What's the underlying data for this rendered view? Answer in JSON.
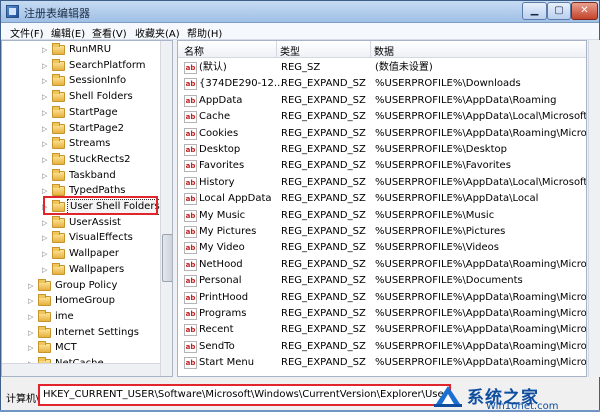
{
  "window": {
    "title": "注册表编辑器"
  },
  "menu": [
    "文件(F)",
    "编辑(E)",
    "查看(V)",
    "收藏夹(A)",
    "帮助(H)"
  ],
  "tree": {
    "items": [
      {
        "label": "RunMRU"
      },
      {
        "label": "SearchPlatform"
      },
      {
        "label": "SessionInfo"
      },
      {
        "label": "Shell Folders"
      },
      {
        "label": "StartPage"
      },
      {
        "label": "StartPage2"
      },
      {
        "label": "Streams"
      },
      {
        "label": "StuckRects2"
      },
      {
        "label": "Taskband"
      },
      {
        "label": "TypedPaths"
      },
      {
        "label": "User Shell Folders",
        "selected": true
      },
      {
        "label": "UserAssist"
      },
      {
        "label": "VisualEffects"
      },
      {
        "label": "Wallpaper"
      },
      {
        "label": "Wallpapers"
      },
      {
        "label": "Group Policy"
      },
      {
        "label": "HomeGroup"
      },
      {
        "label": "ime"
      },
      {
        "label": "Internet Settings"
      },
      {
        "label": "MCT"
      },
      {
        "label": "NetCache"
      }
    ]
  },
  "list": {
    "columns": [
      "名称",
      "类型",
      "数据"
    ],
    "rows": [
      {
        "name": "(默认)",
        "type": "REG_SZ",
        "data": "(数值未设置)"
      },
      {
        "name": "{374DE290-12...",
        "type": "REG_EXPAND_SZ",
        "data": "%USERPROFILE%\\Downloads"
      },
      {
        "name": "AppData",
        "type": "REG_EXPAND_SZ",
        "data": "%USERPROFILE%\\AppData\\Roaming"
      },
      {
        "name": "Cache",
        "type": "REG_EXPAND_SZ",
        "data": "%USERPROFILE%\\AppData\\Local\\Microsoft\\..."
      },
      {
        "name": "Cookies",
        "type": "REG_EXPAND_SZ",
        "data": "%USERPROFILE%\\AppData\\Roaming\\Microso"
      },
      {
        "name": "Desktop",
        "type": "REG_EXPAND_SZ",
        "data": "%USERPROFILE%\\Desktop"
      },
      {
        "name": "Favorites",
        "type": "REG_EXPAND_SZ",
        "data": "%USERPROFILE%\\Favorites"
      },
      {
        "name": "History",
        "type": "REG_EXPAND_SZ",
        "data": "%USERPROFILE%\\AppData\\Local\\Microsoft\\..."
      },
      {
        "name": "Local AppData",
        "type": "REG_EXPAND_SZ",
        "data": "%USERPROFILE%\\AppData\\Local"
      },
      {
        "name": "My Music",
        "type": "REG_EXPAND_SZ",
        "data": "%USERPROFILE%\\Music"
      },
      {
        "name": "My Pictures",
        "type": "REG_EXPAND_SZ",
        "data": "%USERPROFILE%\\Pictures"
      },
      {
        "name": "My Video",
        "type": "REG_EXPAND_SZ",
        "data": "%USERPROFILE%\\Videos"
      },
      {
        "name": "NetHood",
        "type": "REG_EXPAND_SZ",
        "data": "%USERPROFILE%\\AppData\\Roaming\\Microsc"
      },
      {
        "name": "Personal",
        "type": "REG_EXPAND_SZ",
        "data": "%USERPROFILE%\\Documents"
      },
      {
        "name": "PrintHood",
        "type": "REG_EXPAND_SZ",
        "data": "%USERPROFILE%\\AppData\\Roaming\\Microsc"
      },
      {
        "name": "Programs",
        "type": "REG_EXPAND_SZ",
        "data": "%USERPROFILE%\\AppData\\Roaming\\Microsoft\\..."
      },
      {
        "name": "Recent",
        "type": "REG_EXPAND_SZ",
        "data": "%USERPROFILE%\\AppData\\Roaming\\Microsc"
      },
      {
        "name": "SendTo",
        "type": "REG_EXPAND_SZ",
        "data": "%USERPROFILE%\\AppData\\Roaming\\Microsc"
      },
      {
        "name": "Start Menu",
        "type": "REG_EXPAND_SZ",
        "data": "%USERPROFILE%\\AppData\\Roaming\\Microsc"
      }
    ]
  },
  "status": {
    "label": "计算机\\",
    "path": "HKEY_CURRENT_USER\\Software\\Microsoft\\Windows\\CurrentVersion\\Explorer\\User Sh"
  },
  "watermark": {
    "brand": "系统之家",
    "site": "Win10net.com"
  },
  "colors": {
    "highlight": "#e0262c",
    "titlebar": "#9fbfe6",
    "watermark": "#0e4da0"
  }
}
